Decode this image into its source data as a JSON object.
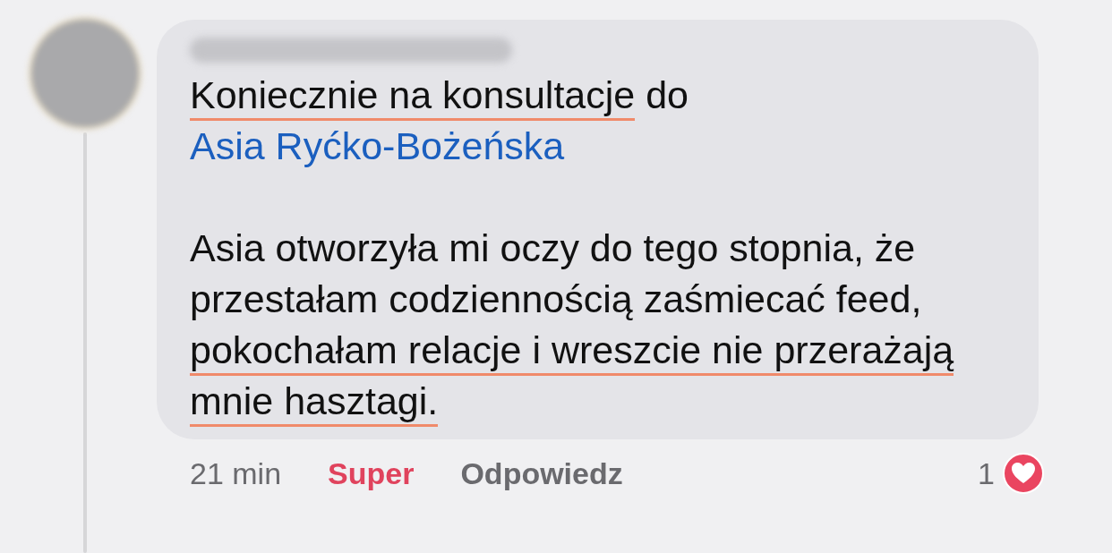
{
  "comment": {
    "paragraphs": [
      {
        "segments": [
          {
            "text": "Koniecznie na konsultacje",
            "underlined": true
          },
          {
            "text": " do ",
            "underlined": false
          },
          {
            "text": "Asia Ryćko-Bożeńska",
            "kind": "mention",
            "underlined": false
          }
        ]
      },
      {
        "segments": [
          {
            "text": "Asia otworzyła mi oczy do tego stopnia, że przestałam codziennością zaśmiecać feed, ",
            "underlined": false
          },
          {
            "text": "pokochałam relacje i wreszcie nie przerażają mnie hasztagi.",
            "underlined": true
          }
        ]
      }
    ],
    "time": "21 min",
    "reaction_label": "Super",
    "reacted": true,
    "reply_label": "Odpowiedz",
    "reaction_count": "1"
  }
}
